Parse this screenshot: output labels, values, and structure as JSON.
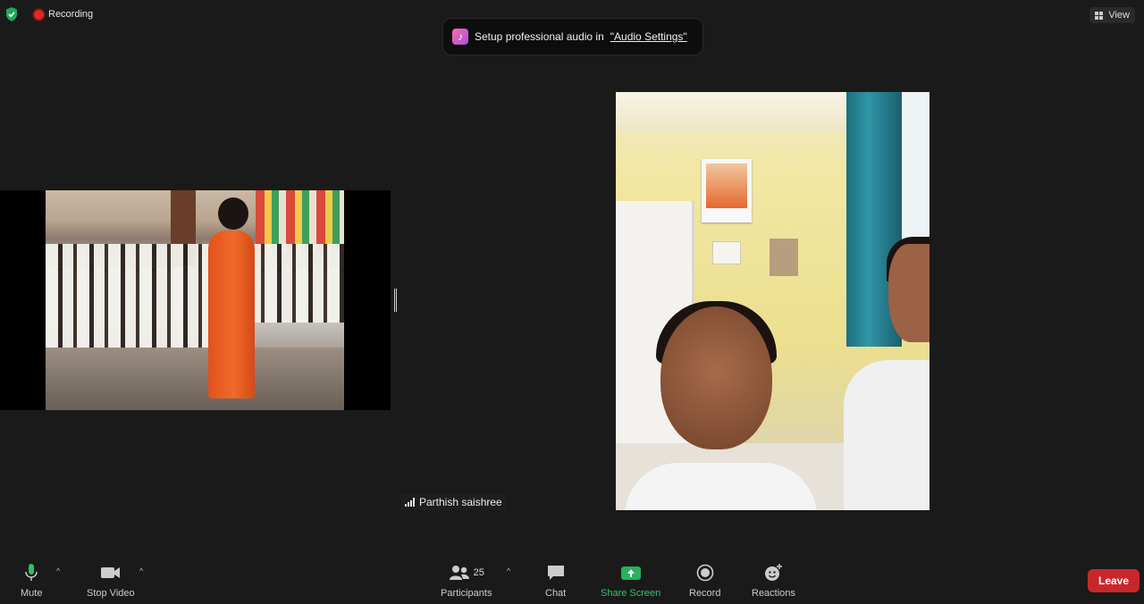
{
  "status": {
    "recording_label": "Recording",
    "shield_color": "#1fa85a",
    "recording_color": "#e02828"
  },
  "view_button": {
    "label": "View"
  },
  "toast": {
    "text": "Setup professional audio in",
    "link": "\"Audio Settings\""
  },
  "participant": {
    "name": "Parthish saishree"
  },
  "toolbar": {
    "mute": "Mute",
    "stop_video": "Stop Video",
    "participants": "Participants",
    "participants_count": "25",
    "chat": "Chat",
    "share_screen": "Share Screen",
    "record": "Record",
    "reactions": "Reactions",
    "leave": "Leave",
    "caret_up": "^"
  },
  "colors": {
    "share_green": "#27b15d",
    "leave_red": "#c8282b",
    "background": "#1a1a1a"
  }
}
